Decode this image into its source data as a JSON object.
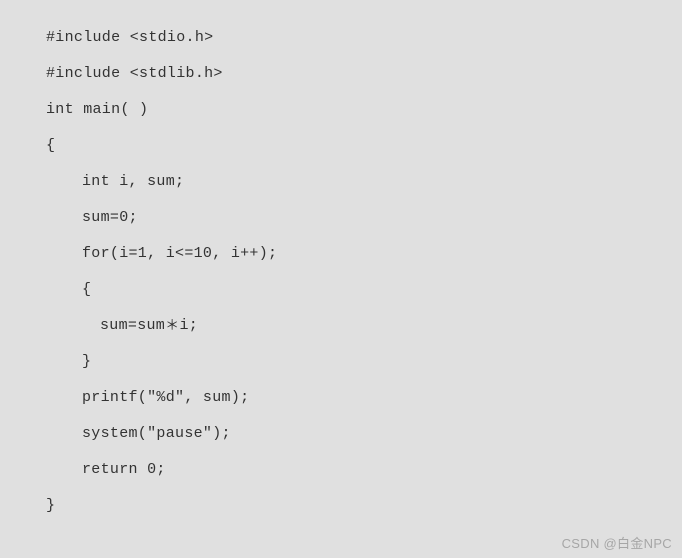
{
  "code": {
    "l1": "#include <stdio.h>",
    "l2": "#include <stdlib.h>",
    "l3": "int main( )",
    "l4": "{",
    "l5": "int i, sum;",
    "l6": "sum=0;",
    "l7": "for(i=1, i<=10, i++);",
    "l8": "{",
    "l9a": "sum=sum",
    "l9b": "i;",
    "l10": "}",
    "l11": "printf(\"%d\", sum);",
    "l12": "system(\"pause\");",
    "l13": "return 0;",
    "l14": "}"
  },
  "watermark": "CSDN @白金NPC"
}
